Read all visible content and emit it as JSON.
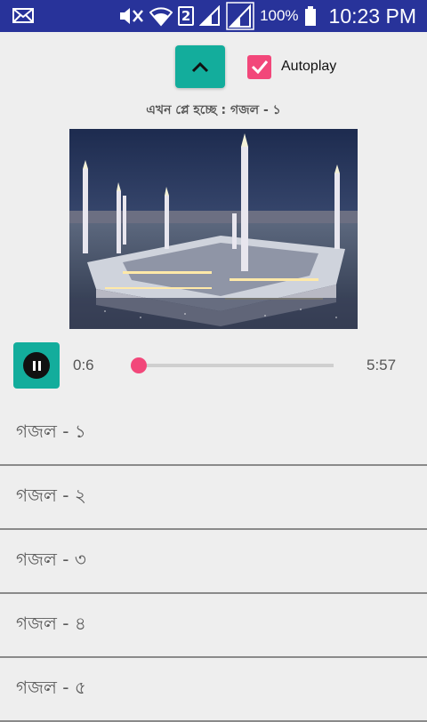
{
  "status_bar": {
    "battery_text": "100%",
    "time": "10:23 PM",
    "sim_slot": "2",
    "icons": [
      "mail-icon",
      "mute-icon",
      "wifi-icon",
      "sim-icon",
      "signal-icon",
      "signal-icon",
      "battery-icon"
    ]
  },
  "controls": {
    "collapse_icon": "chevron-up-icon",
    "autoplay_label": "Autoplay",
    "autoplay_checked": true
  },
  "now_playing": {
    "text": "এখন প্লে হচ্ছে : গজল - ১"
  },
  "player": {
    "current_time": "0:6",
    "total_time": "5:57",
    "progress": 0.017,
    "state": "playing"
  },
  "tracks": [
    {
      "label": "গজল - ১"
    },
    {
      "label": "গজল - ২"
    },
    {
      "label": "গজল - ৩"
    },
    {
      "label": "গজল - ৪"
    },
    {
      "label": "গজল - ৫"
    }
  ],
  "colors": {
    "status_bar": "#28339a",
    "accent_teal": "#13ad9c",
    "accent_pink": "#f2477a",
    "background": "#eeeeee"
  }
}
